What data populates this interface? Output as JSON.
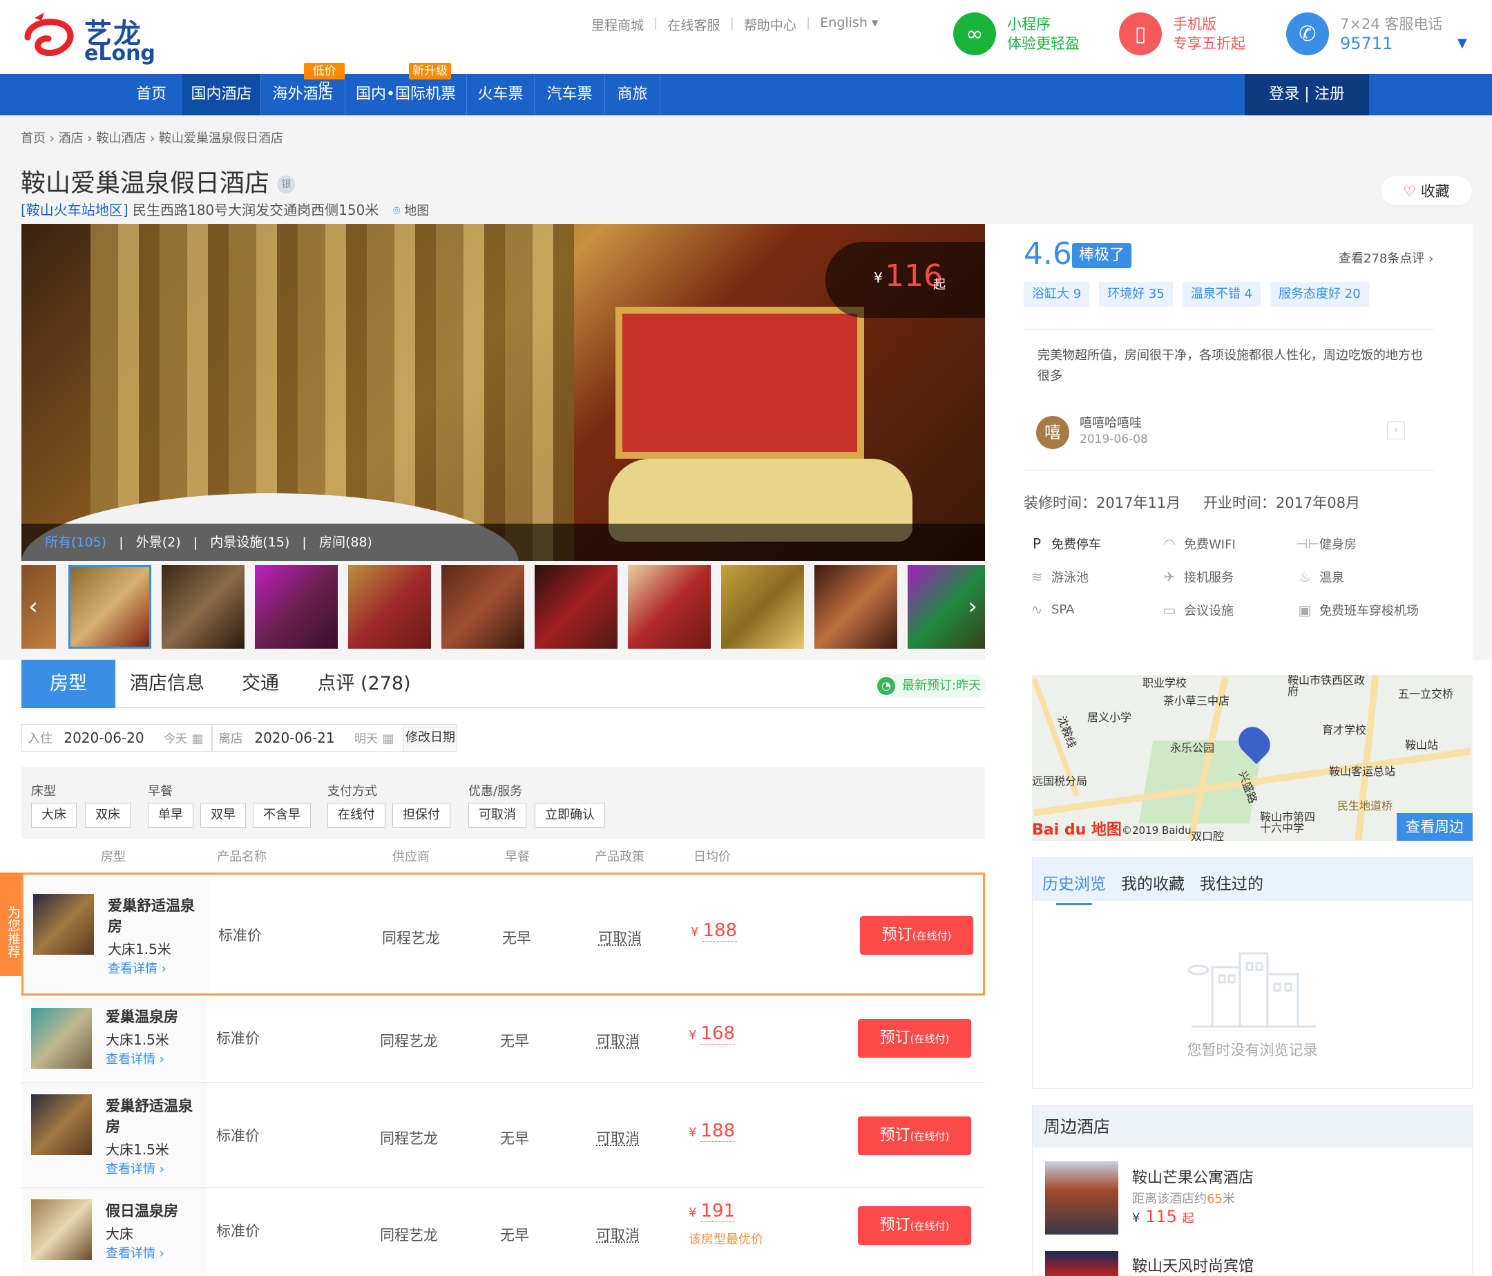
{
  "header": {
    "logo_cn": "艺龙",
    "logo_en": "eLong",
    "links": [
      "里程商城",
      "在线客服",
      "帮助中心",
      "English"
    ],
    "promos": [
      {
        "line1": "小程序",
        "line2": "体验更轻盈",
        "color": "#19b43b",
        "icon": "mini-program-icon"
      },
      {
        "line1": "手机版",
        "line2": "专享五折起",
        "color": "#f75a5a",
        "icon": "phone-icon"
      },
      {
        "line1": "7×24 客服电话",
        "line2": "95711",
        "color": "#3a8ee6",
        "icon": "hotline-icon"
      }
    ]
  },
  "nav": {
    "items": [
      "首页",
      "国内酒店",
      "海外酒店",
      "国内•国际机票",
      "火车票",
      "汽车票",
      "商旅"
    ],
    "active": "国内酒店",
    "badges": {
      "overseas": "低价促",
      "flights": "新升级"
    },
    "login": "登录 | 注册"
  },
  "breadcrumb": [
    "首页",
    "酒店",
    "鞍山酒店",
    "鞍山爱巢温泉假日酒店"
  ],
  "hotel": {
    "name": "鞍山爱巢温泉假日酒店",
    "level_badge": "银",
    "area": "[鞍山火车站地区]",
    "address": "民生西路180号大润发交通岗西侧150米",
    "map_link": "地图",
    "fav": "收藏"
  },
  "gallery": {
    "price_currency": "¥",
    "price": "116",
    "price_suffix": "起",
    "tabs": [
      "所有(105)",
      "外景(2)",
      "内景设施(15)",
      "房间(88)"
    ],
    "active_tab": "所有(105)"
  },
  "reviews": {
    "score": "4.6",
    "score_label": "棒极了",
    "see_all": "查看278条点评",
    "tags": [
      "浴缸大 9",
      "环境好 35",
      "温泉不错 4",
      "服务态度好 20"
    ],
    "text": "完美物超所值，房间很干净，各项设施都很人性化，周边吃饭的地方也很多",
    "user_initial": "嘻",
    "user": "嘻嘻哈嘻哇",
    "date": "2019-06-08"
  },
  "info": {
    "renovated": "装修时间：2017年11月",
    "opened": "开业时间：2017年08月"
  },
  "facilities": [
    {
      "label": "免费停车",
      "icon": "parking-icon",
      "available": true
    },
    {
      "label": "免费WIFI",
      "icon": "wifi-icon",
      "available": false
    },
    {
      "label": "健身房",
      "icon": "gym-icon",
      "available": false
    },
    {
      "label": "游泳池",
      "icon": "pool-icon",
      "available": false
    },
    {
      "label": "接机服务",
      "icon": "airport-pickup-icon",
      "available": false
    },
    {
      "label": "温泉",
      "icon": "hot-spring-icon",
      "available": false
    },
    {
      "label": "SPA",
      "icon": "spa-icon",
      "available": false
    },
    {
      "label": "会议设施",
      "icon": "meeting-icon",
      "available": false
    },
    {
      "label": "免费班车穿梭机场",
      "icon": "shuttle-icon",
      "available": false
    }
  ],
  "tabs": {
    "items": [
      "房型",
      "酒店信息",
      "交通",
      "点评 (278)"
    ],
    "active": "房型",
    "latest": "最新预订:昨天"
  },
  "booking": {
    "checkin_label": "入住",
    "checkin": "2020-06-20",
    "checkin_rel": "今天",
    "checkout_label": "离店",
    "checkout": "2020-06-21",
    "checkout_rel": "明天",
    "modify": "修改日期"
  },
  "filters": {
    "bed": {
      "label": "床型",
      "options": [
        "大床",
        "双床"
      ]
    },
    "breakfast": {
      "label": "早餐",
      "options": [
        "单早",
        "双早",
        "不含早"
      ]
    },
    "payment": {
      "label": "支付方式",
      "options": [
        "在线付",
        "担保付"
      ]
    },
    "service": {
      "label": "优惠/服务",
      "options": [
        "可取消",
        "立即确认"
      ]
    }
  },
  "columns": [
    "房型",
    "产品名称",
    "供应商",
    "早餐",
    "产品政策",
    "日均价"
  ],
  "recommend_flag": "为您推荐",
  "rooms": [
    {
      "name": "爱巢舒适温泉房",
      "bed": "大床1.5米",
      "more": "查看详情 ›",
      "product": "标准价",
      "supplier": "同程艺龙",
      "breakfast": "无早",
      "policy": "可取消",
      "currency": "¥",
      "price": "188",
      "note": "",
      "book": "预订",
      "book_sub": "(在线付)"
    },
    {
      "name": "爱巢温泉房",
      "bed": "大床1.5米",
      "more": "查看详情 ›",
      "product": "标准价",
      "supplier": "同程艺龙",
      "breakfast": "无早",
      "policy": "可取消",
      "currency": "¥",
      "price": "168",
      "note": "",
      "book": "预订",
      "book_sub": "(在线付)"
    },
    {
      "name": "爱巢舒适温泉房",
      "bed": "大床1.5米",
      "more": "查看详情 ›",
      "product": "标准价",
      "supplier": "同程艺龙",
      "breakfast": "无早",
      "policy": "可取消",
      "currency": "¥",
      "price": "188",
      "note": "",
      "book": "预订",
      "book_sub": "(在线付)"
    },
    {
      "name": "假日温泉房",
      "bed": "大床",
      "more": "查看详情 ›",
      "product": "标准价",
      "supplier": "同程艺龙",
      "breakfast": "无早",
      "policy": "可取消",
      "currency": "¥",
      "price": "191",
      "note": "该房型最优价",
      "book": "预订",
      "book_sub": "(在线付)"
    }
  ],
  "map": {
    "labels": [
      "职业学校",
      "鞍山市铁西区政府",
      "五一立交桥",
      "茶小草三中店",
      "居义小学",
      "育才学校",
      "永乐公园",
      "鞍山站",
      "沈鞍线",
      "鞍山客运总站",
      "远国税分局",
      "兴盛路",
      "民生地道桥",
      "鞍山市第四十六中学",
      "双口腔"
    ],
    "logo": "Bai du 地图",
    "copyright": "©2019 Baidu",
    "nearby_button": "查看周边"
  },
  "history": {
    "tabs": [
      "历史浏览",
      "我的收藏",
      "我住过的"
    ],
    "active": "历史浏览",
    "empty": "您暂时没有浏览记录"
  },
  "nearby_hotels": {
    "title": "周边酒店",
    "items": [
      {
        "name": "鞍山芒果公寓酒店",
        "distance_prefix": "距离该酒店约",
        "distance": "65",
        "distance_unit": "米",
        "currency": "¥",
        "price": "115",
        "suffix": "起"
      },
      {
        "name": "鞍山天风时尚宾馆"
      }
    ]
  }
}
